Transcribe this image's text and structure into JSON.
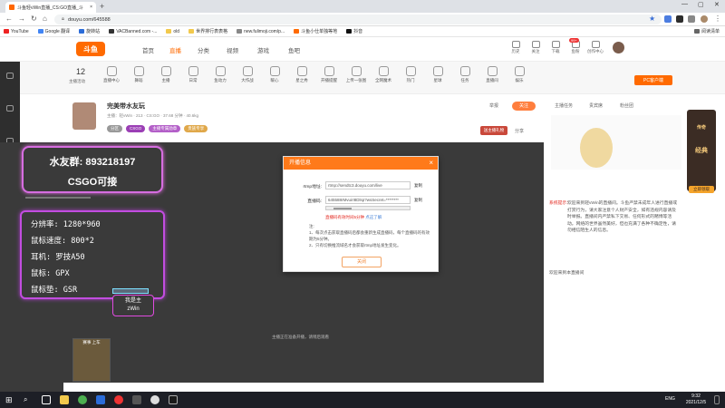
{
  "browser": {
    "tab_title": "斗鱼轻vWin直播_CS:GO直播_斗",
    "url": "douyu.com/645588",
    "bookmarks": [
      "YouTube",
      "Google 翻译",
      "旋转站",
      "VACBanned.com -...",
      "old",
      "世界排行表表格",
      "new.fulimoji.com/p...",
      "斗鱼小仕单独等地",
      "抖音"
    ],
    "reading_list": "阅读清单"
  },
  "topnav": {
    "logo": "斗鱼",
    "items": [
      "首页",
      "直播",
      "分类",
      "视频",
      "游戏",
      "鱼吧"
    ],
    "active_index": 1,
    "right_items": [
      "历史",
      "关注",
      "下载",
      "鱼粉",
      "创作中心",
      "消息"
    ],
    "right_badge": "99+"
  },
  "categories": {
    "count": "12",
    "count_label": "主播活动",
    "items": [
      "直播中心",
      "舞蹈",
      "主播",
      "日常",
      "鱼动力",
      "大作战",
      "暖心",
      "星之秀",
      "开播提醒",
      "上传一张图",
      "全网魔术",
      "热门",
      "星球",
      "任务",
      "直播间",
      "娱乐"
    ],
    "pc_button": "PC客户端"
  },
  "room": {
    "title": "完美带水友玩",
    "meta": "主播：轻vWin  ·  213  ·  CS:GO  ·  37.68 分钟  ·  40.6kg",
    "tags": [
      "分区",
      "CSGO",
      "主播专属勋章",
      "贵族专享"
    ],
    "report": "举报",
    "follow": "关注",
    "share": "分享",
    "gift": "送主播礼物"
  },
  "overlay": {
    "qq_group": "水友群: 893218197",
    "csgo": "CSGO可接",
    "specs": [
      "分辨率: 1280*960",
      "鼠标速度: 800*2",
      "耳机: 罗技A50",
      "鼠标: GPX",
      "鼠标垫: GSR"
    ],
    "badge_line1": "我是主",
    "badge_line2": "zWin",
    "game_label": "赛事 上车",
    "caption": "主播正在准备开播，请稍后观看"
  },
  "modal": {
    "title": "开播信息",
    "rtmp_label": "rtmp地址:",
    "rtmp_value": "rtmp://sendtc3.douyu.com/live",
    "key_label": "直播码:",
    "key_value": "645588rMvuirI8Dlsp?wsSecret=********",
    "copy": "复制",
    "warning": "直播码有效时间5分钟",
    "warning_link": "点这了解",
    "note_title": "注:",
    "notes": [
      "1、每次点击获取直播码后都会重新生成直播码，每个直播码的有效期为5分钟。",
      "2、只有切换推流域名才会获取rtmp地址发生变化。"
    ],
    "close": "关闭"
  },
  "right_panel": {
    "tabs": [
      "主播任务",
      "贵宾席",
      "粉丝团"
    ],
    "announcement_label": "系统提示：",
    "announcement": "欢迎来到轻vWin的直播间。斗鱼严禁未成年人进行直播或打赏行为，请大家注意个人财产安全，如有违规内容请及时举报。直播间内严禁私下交易、任何形式的赌博等活动。网络的世界虽然美好，但也充满了各种不确定性，请勿相信陌生人的信息。",
    "welcome": "欢迎来到本直播间",
    "ad_title": "传奇",
    "ad_sub": "经典",
    "ad_btn": "立即领取"
  },
  "taskbar": {
    "time": "9:32",
    "date": "2021/12/5",
    "lang": "ENG"
  },
  "colors": {
    "brand": "#ff6a00",
    "neon_pink": "#e06bdf",
    "player_bg": "#3a3a3a"
  }
}
